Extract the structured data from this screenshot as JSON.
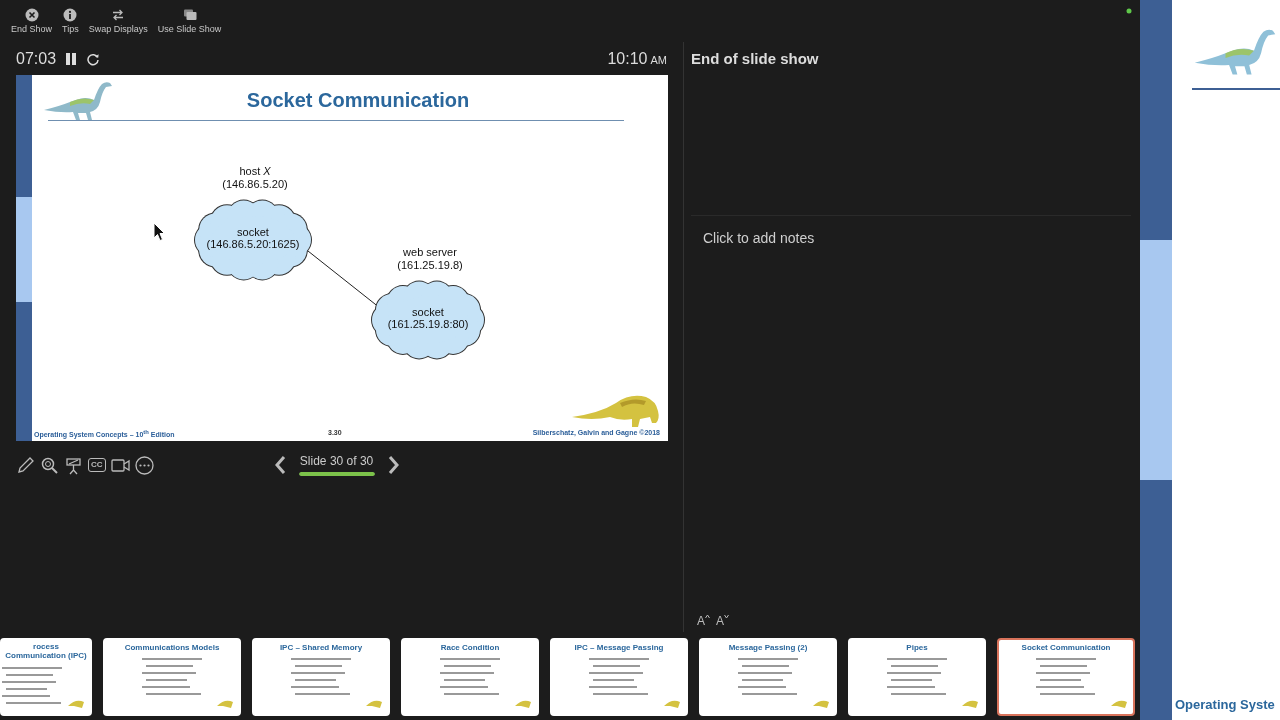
{
  "toolbar": [
    {
      "kind": "end",
      "label": "End Show"
    },
    {
      "kind": "tips",
      "label": "Tips"
    },
    {
      "kind": "swap",
      "label": "Swap Displays"
    },
    {
      "kind": "slideshow",
      "label": "Use Slide Show"
    }
  ],
  "timer": {
    "elapsed": "07:03",
    "running": true
  },
  "clock": {
    "time": "10:10",
    "period": "AM"
  },
  "current_slide": {
    "title": "Socket Communication",
    "nodes": [
      {
        "label": "host *X*",
        "address": "(146.86.5.20)",
        "socket_label": "socket",
        "socket_address": "(146.86.5.20:1625)"
      },
      {
        "label": "web server",
        "address": "(161.25.19.8)",
        "socket_label": "socket",
        "socket_address": "(161.25.19.8:80)"
      }
    ],
    "footer_left": "Operating System Concepts – 10$^{th}$ Edition",
    "footer_center": "3.30",
    "footer_right": "Silberschatz, Galvin and Gagne ©2018"
  },
  "tools": [
    {
      "kind": "pen"
    },
    {
      "kind": "zoom"
    },
    {
      "kind": "pointer"
    },
    {
      "kind": "subtitles",
      "label": "CC"
    },
    {
      "kind": "camera"
    },
    {
      "kind": "more"
    }
  ],
  "navigation": {
    "label": "Slide 30 of 30",
    "level": 1
  },
  "notes": {
    "heading": "End of slide show",
    "placeholder": "Click to add notes"
  },
  "font_buttons": [
    {
      "kind": "increase",
      "label": "A"
    },
    {
      "kind": "decrease",
      "label": "A"
    }
  ],
  "thumbnails": [
    {
      "title": "rocess Communication (IPC)",
      "selected": false
    },
    {
      "title": "Communications Models",
      "selected": false
    },
    {
      "title": "IPC – Shared Memory",
      "selected": false
    },
    {
      "title": "Race Condition",
      "selected": false
    },
    {
      "title": "IPC – Message Passing",
      "selected": false
    },
    {
      "title": "Message Passing (2)",
      "selected": false
    },
    {
      "title": "Pipes",
      "selected": false
    },
    {
      "title": "Socket Communication",
      "selected": true
    }
  ],
  "next_preview": {
    "footer": "Operating Syste"
  }
}
